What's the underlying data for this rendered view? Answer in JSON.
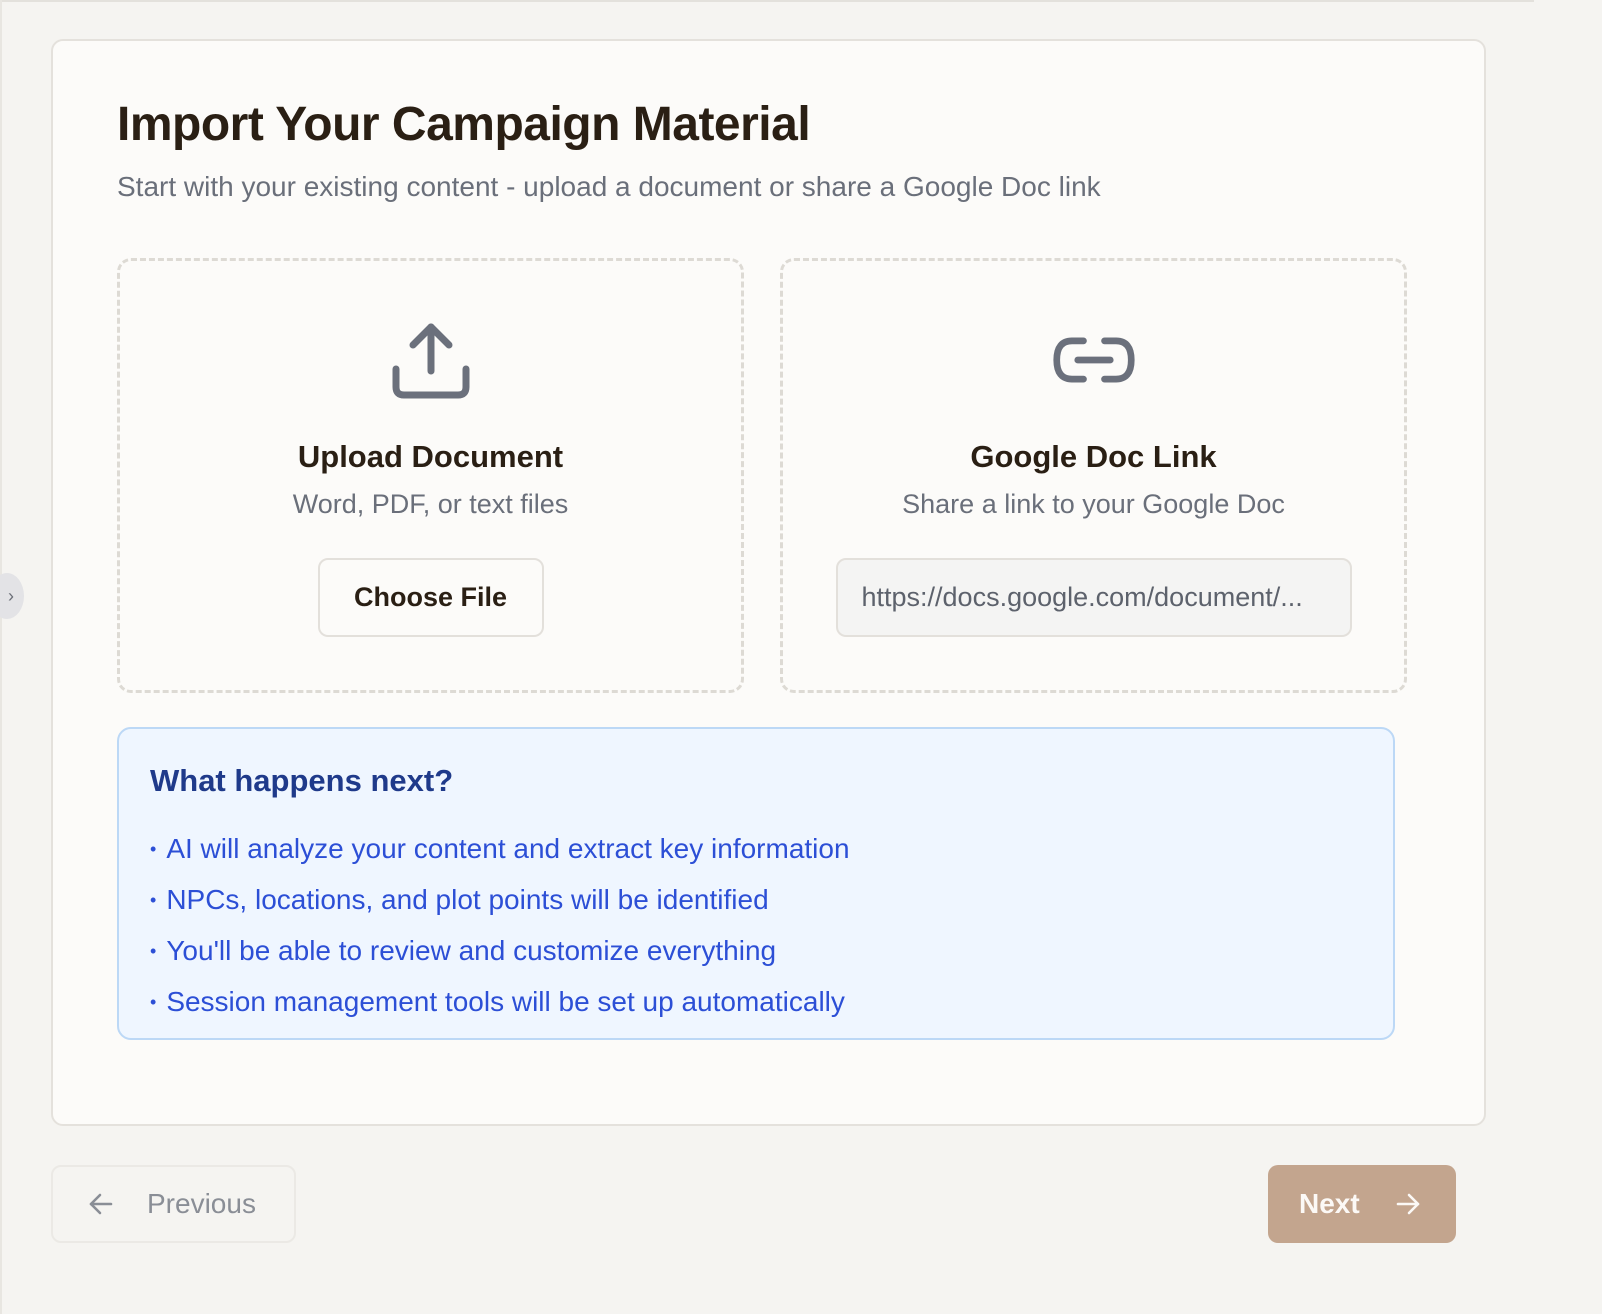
{
  "header": {
    "title": "Import Your Campaign Material",
    "subtitle": "Start with your existing content - upload a document or share a Google Doc link"
  },
  "upload": {
    "icon": "upload-icon",
    "title": "Upload Document",
    "description": "Word, PDF, or text files",
    "button_label": "Choose File"
  },
  "gdoc": {
    "icon": "link-icon",
    "title": "Google Doc Link",
    "description": "Share a link to your Google Doc",
    "input_placeholder": "https://docs.google.com/document/...",
    "input_value": ""
  },
  "info": {
    "title": "What happens next?",
    "items": [
      "AI will analyze your content and extract key information",
      "NPCs, locations, and plot points will be identified",
      "You'll be able to review and customize everything",
      "Session management tools will be set up automatically"
    ]
  },
  "nav": {
    "previous_label": "Previous",
    "previous_icon": "arrow-left-icon",
    "next_label": "Next",
    "next_icon": "arrow-right-icon"
  },
  "colors": {
    "accent": "#c3a58e",
    "info_bg": "#eff6ff",
    "info_text": "#2c4fd6",
    "info_title": "#1f3a8a"
  }
}
